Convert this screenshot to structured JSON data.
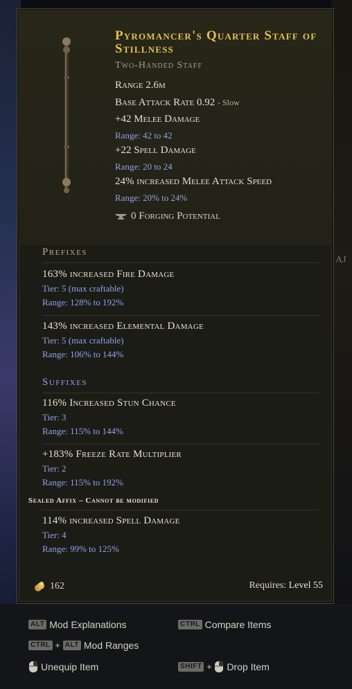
{
  "item": {
    "name": "Pyromancer's Quarter Staff of Stillness",
    "type": "Two-Handed Staff",
    "icon": "staff-icon",
    "base_stats": [
      {
        "text": "Range 2.6m"
      },
      {
        "text": "Base Attack Rate 0.92",
        "note": "- Slow"
      },
      {
        "text": "+42 Melee Damage"
      },
      {
        "text": "Range: 42 to 42",
        "kind": "range"
      },
      {
        "text": "+22 Spell Damage"
      },
      {
        "text": "Range: 20 to 24",
        "kind": "range"
      },
      {
        "text": "24% increased Melee Attack Speed"
      },
      {
        "text": "Range: 20% to 24%",
        "kind": "range"
      }
    ],
    "forging_potential": "0 Forging Potential",
    "prefixes_title": "Prefixes",
    "prefixes": [
      {
        "name": "163% increased Fire Damage",
        "tier": "Tier: 5 (max craftable)",
        "range": "Range: 128% to 192%"
      },
      {
        "name": "143% increased Elemental Damage",
        "tier": "Tier: 5 (max craftable)",
        "range": "Range: 106% to 144%"
      }
    ],
    "suffixes_title": "Suffixes",
    "suffixes": [
      {
        "name": "116% Increased Stun Chance",
        "tier": "Tier: 3",
        "range": "Range: 115% to 144%"
      },
      {
        "name": "+183% Freeze Rate Multiplier",
        "tier": "Tier: 2",
        "range": "Range: 115% to 192%"
      }
    ],
    "sealed_label": "Sealed Affix – Cannot be modified",
    "sealed": {
      "name": "114% increased Spell Damage",
      "tier": "Tier: 4",
      "range": "Range: 99% to 125%"
    },
    "value": "162",
    "requires_label": "Requires:",
    "requires_level": "Level 55"
  },
  "colors": {
    "title": "#e6c04a",
    "prefix_header": "#b9ad86",
    "suffix_header": "#8fa4e8",
    "range_text": "#8ea2e6"
  },
  "hints": [
    {
      "keys": [
        "ALT"
      ],
      "label": "Mod Explanations"
    },
    {
      "keys": [
        "CTRL"
      ],
      "label": "Compare Items"
    },
    {
      "keys": [
        "CTRL",
        "ALT"
      ],
      "label": "Mod Ranges"
    },
    {
      "keys": [
        "mouse"
      ],
      "label": "Unequip Item"
    },
    {
      "keys": [
        "SHIFT",
        "mouse"
      ],
      "label": "Drop Item"
    }
  ],
  "side_text": "AJ"
}
